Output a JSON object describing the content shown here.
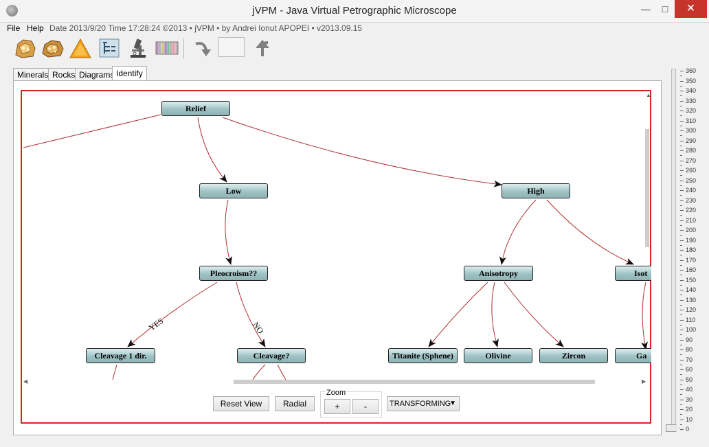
{
  "window": {
    "title": "jVPM - Java Virtual Petrographic Microscope",
    "minimize": "—",
    "maximize": "□",
    "close": "✕"
  },
  "menubar": {
    "file": "File",
    "help": "Help",
    "info": "Date 2013/9/20   Time 17:28:24   ©2013 • jVPM • by Andrei Ionut APOPEI • v2013.09.15"
  },
  "toolbar": {
    "icons": [
      "mineral-sample-icon",
      "rock-sample-icon",
      "triangle-diagram-icon",
      "identify-tree-icon",
      "microscope-icon",
      "color-chart-icon",
      "rotate-cw-icon",
      "blank-preview",
      "rotate-ccw-icon"
    ]
  },
  "tabs": [
    {
      "label": "Minerals"
    },
    {
      "label": "Rocks"
    },
    {
      "label": "Diagrams"
    },
    {
      "label": "Identify",
      "active": true
    }
  ],
  "graph": {
    "nodes": {
      "relief": "Relief",
      "low": "Low",
      "high": "High",
      "pleocroism": "Pleocroism??",
      "anisotropy": "Anisotropy",
      "iso": "Isot",
      "cleavage1": "Cleavage 1 dir.",
      "cleavage": "Cleavage?",
      "titanite": "Titanite (Sphene)",
      "olivine": "Olivine",
      "zircon": "Zircon",
      "ga": "Ga"
    },
    "edge_labels": {
      "yes": "YES",
      "no": "NO"
    },
    "edge_color": "#b03030"
  },
  "controls": {
    "reset_view": "Reset View",
    "radial": "Radial",
    "zoom_label": "Zoom",
    "zoom_in": "+",
    "zoom_out": "-",
    "mode": "TRANSFORMING"
  },
  "slider": {
    "min": 0,
    "max": 360,
    "step_label": 10,
    "value": 0
  }
}
